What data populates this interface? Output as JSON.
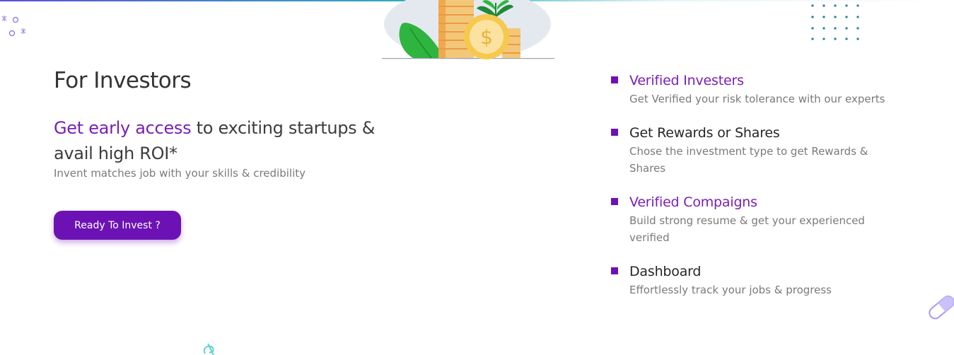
{
  "investors": {
    "title": "For Investors",
    "headline_accent": "Get early access",
    "headline_rest": " to exciting startups & avail high ROI*",
    "subline": "Invent matches job with your skills & credibility",
    "cta_label": "Ready To Invest ?"
  },
  "features": [
    {
      "title": "Verified Investers",
      "desc": "Get Verified your risk tolerance with our experts",
      "title_color": "purple"
    },
    {
      "title": "Get Rewards or Shares",
      "desc": "Chose the investment type to get Rewards & Shares",
      "title_color": "dark"
    },
    {
      "title": "Verified Compaigns",
      "desc": "Build strong resume & get your experienced verified",
      "title_color": "purple"
    },
    {
      "title": "Dashboard",
      "desc": "Effortlessly track your jobs & progress",
      "title_color": "dark"
    }
  ],
  "colors": {
    "accent": "#7a1fb3",
    "button": "#6c12b5",
    "muted_text": "#7a7a7a",
    "heading": "#333333"
  },
  "icons": {
    "hero": "coins-and-plant-illustration",
    "decor_top_left": "sparkle-circles-icon",
    "decor_dots": "dot-grid-icon",
    "decor_pill": "capsule-icon",
    "decor_bottom": "spiral-icon"
  }
}
